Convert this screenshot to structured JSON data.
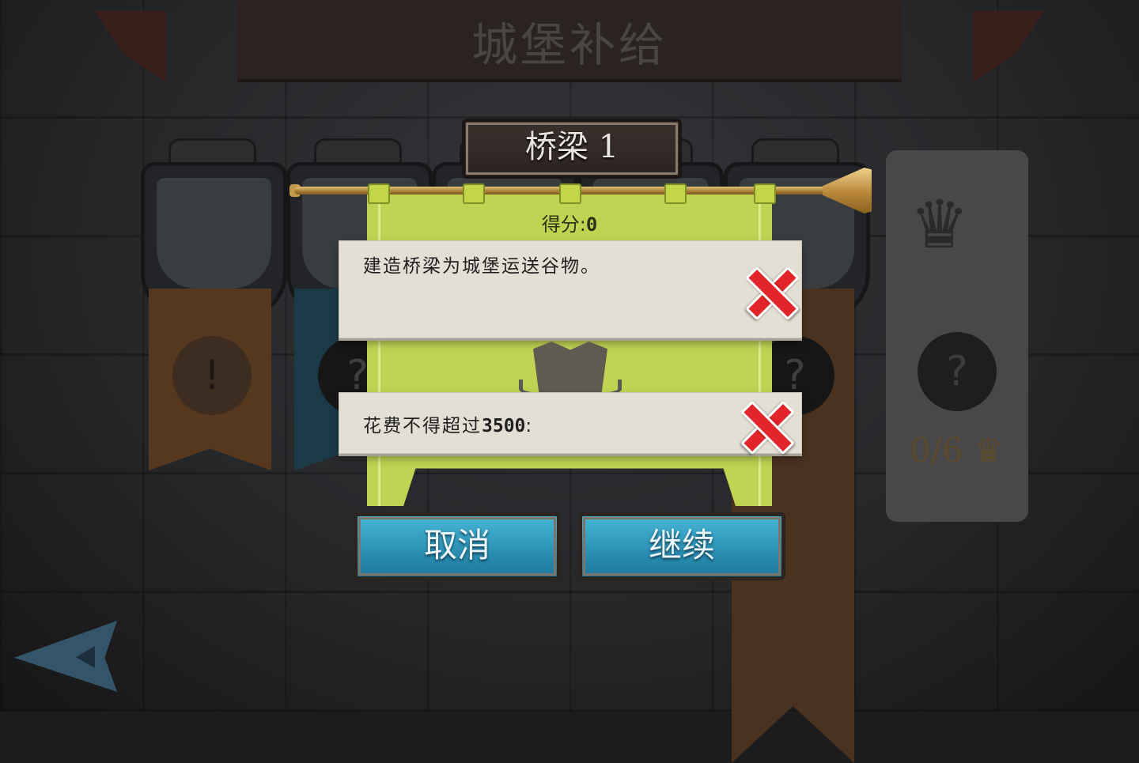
{
  "background": {
    "screen_title": "城堡补给",
    "crown_progress": "0/6",
    "locked_marker": "?"
  },
  "dialog": {
    "level_name": "桥梁 1",
    "score_label": "得分:",
    "score_value": "0",
    "objectives": [
      {
        "text": "建造桥梁为城堡运送谷物。",
        "status_icon": "red-x-icon"
      },
      {
        "text_prefix": "花费不得超过",
        "limit": "3500",
        "text_suffix": ":",
        "status_icon": "red-x-icon"
      }
    ],
    "cancel_label": "取消",
    "continue_label": "继续"
  },
  "colors": {
    "flag": "#c0d353",
    "button": "#2a8fb4",
    "fail_x": "#e2252b"
  }
}
